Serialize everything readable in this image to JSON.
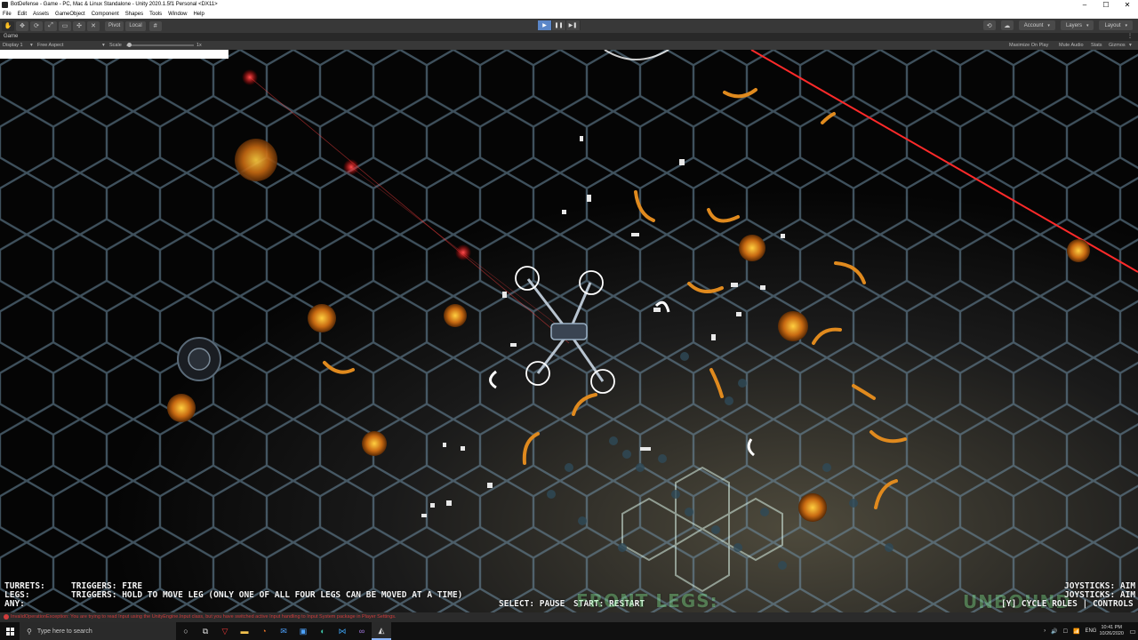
{
  "window": {
    "title": "BotDefense - Game - PC, Mac & Linux Standalone - Unity 2020.1.5f1 Personal <DX11>",
    "controls": [
      "–",
      "☐",
      "✕"
    ]
  },
  "menu": [
    "File",
    "Edit",
    "Assets",
    "GameObject",
    "Component",
    "Shapes",
    "Tools",
    "Window",
    "Help"
  ],
  "toolbar": {
    "tools": [
      "✋",
      "✥",
      "⟳",
      "⤢",
      "▭",
      "✣",
      "✕"
    ],
    "pivot_label": "Pivot",
    "local_label": "Local",
    "grid_glyph": "#",
    "play_glyph": "▶",
    "pause_glyph": "❚❚",
    "step_glyph": "▶❚",
    "collab_glyph": "☁",
    "history_glyph": "⟲",
    "account_label": "Account",
    "layers_label": "Layers",
    "layout_label": "Layout",
    "caret": "▾"
  },
  "game_tab": {
    "label": "Game",
    "menu_glyph": "⋮",
    "display": "Display 1",
    "aspect": "Free Aspect",
    "scale_label": "Scale",
    "scale_value": "1x",
    "maximize": "Maximize On Play",
    "mute": "Mute Audio",
    "stats": "Stats",
    "gizmos": "Gizmos"
  },
  "hud": {
    "turrets_label": "TURRETS:",
    "turrets_text": "TRIGGERS: FIRE",
    "legs_label": "LEGS:",
    "legs_text": "TRIGGERS: HOLD TO MOVE LEG (ONLY ONE OF ALL FOUR LEGS CAN BE MOVED AT A TIME)",
    "any_label": "ANY:",
    "select_text": "SELECT: PAUSE",
    "start_text": "START: RESTART",
    "front_legs": "FRONT LEGS:",
    "unbound": "UNBOUND",
    "joystick_1": "JOYSTICKS: AIM",
    "joystick_2": "JOYSTICKS: AIM",
    "cycle_text": "[Y] CYCLE ROLES | CONTROLS"
  },
  "console": {
    "message": "InvalidOperationException: You are trying to read Input using the UnityEngine.Input class, but you have switched active Input handling to Input System package in Player Settings."
  },
  "taskbar": {
    "search_placeholder": "Type here to search",
    "search_glyph": "⚲",
    "apps": [
      {
        "name": "task-view-icon",
        "glyph": "○"
      },
      {
        "name": "widgets-icon",
        "glyph": "⧉"
      },
      {
        "name": "vivaldi-icon",
        "glyph": "▽"
      },
      {
        "name": "file-explorer-icon",
        "glyph": "▬"
      },
      {
        "name": "blender-icon",
        "glyph": "◔"
      },
      {
        "name": "mail-icon",
        "glyph": "✉"
      },
      {
        "name": "photos-icon",
        "glyph": "▣"
      },
      {
        "name": "edge-icon",
        "glyph": "◐"
      },
      {
        "name": "vscode-icon",
        "glyph": "⋈"
      },
      {
        "name": "visual-studio-icon",
        "glyph": "∞"
      },
      {
        "name": "unity-icon",
        "glyph": "◭"
      }
    ],
    "tray_icons": [
      "›",
      "🔊",
      "☐",
      "📶"
    ],
    "lang": "ENG",
    "time": "10:41 PM",
    "date": "10/26/2020",
    "notify_glyph": "▭"
  },
  "colors": {
    "accent": "#5a86c8",
    "hex_line": "#6f8fa6",
    "orange": "#e08a1e",
    "laser": "#ff2a2a"
  }
}
